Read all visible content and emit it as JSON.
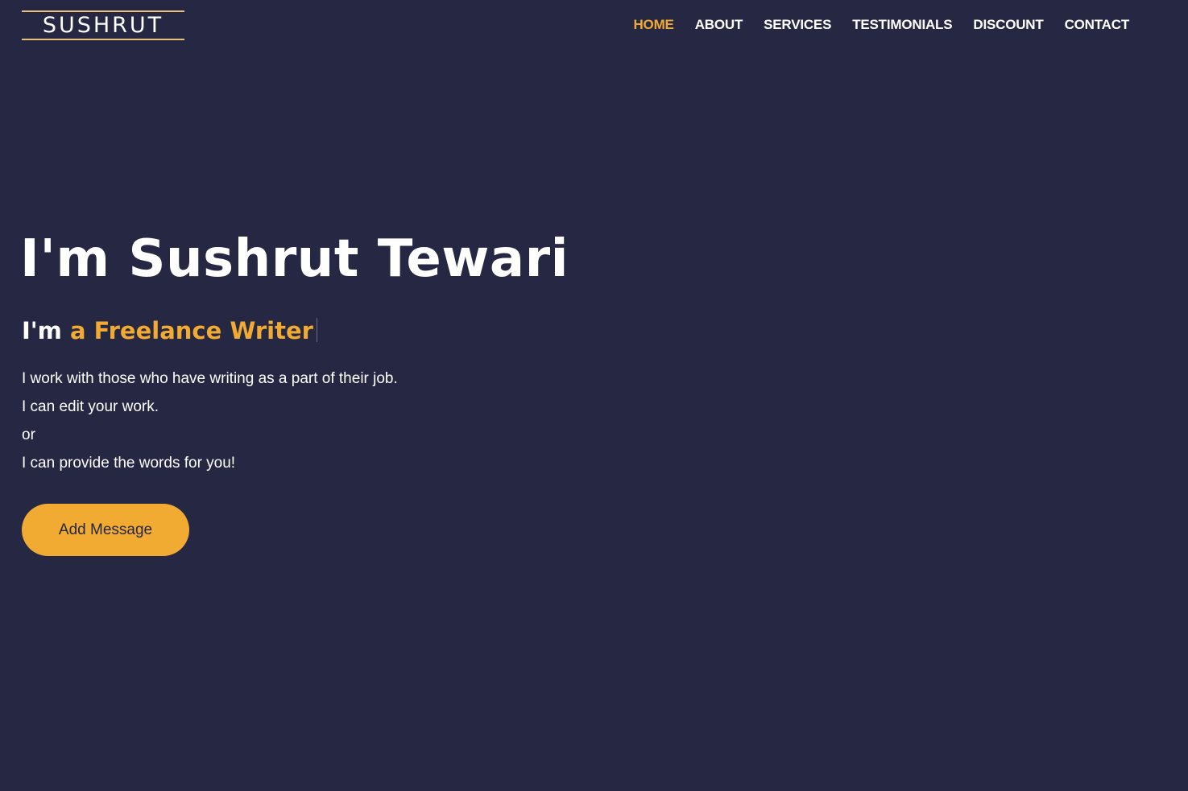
{
  "header": {
    "logo_text": "SUSHRUT",
    "nav": [
      {
        "label": "HOME",
        "active": true
      },
      {
        "label": "ABOUT",
        "active": false
      },
      {
        "label": "SERVICES",
        "active": false
      },
      {
        "label": "TESTIMONIALS",
        "active": false
      },
      {
        "label": "DISCOUNT",
        "active": false
      },
      {
        "label": "CONTACT",
        "active": false
      }
    ]
  },
  "hero": {
    "title": "I'm Sushrut Tewari",
    "subtitle_prefix": "I'm",
    "subtitle_typed": "a Freelance Writer",
    "lines": [
      "I work with those who have writing as a part of their job.",
      "I can edit your work.",
      "or",
      "I can provide the words for you!"
    ],
    "cta_label": "Add Message"
  },
  "colors": {
    "background": "#252743",
    "accent": "#f1aa32",
    "text": "#ffffff",
    "logo_border": "#e8c27a"
  }
}
